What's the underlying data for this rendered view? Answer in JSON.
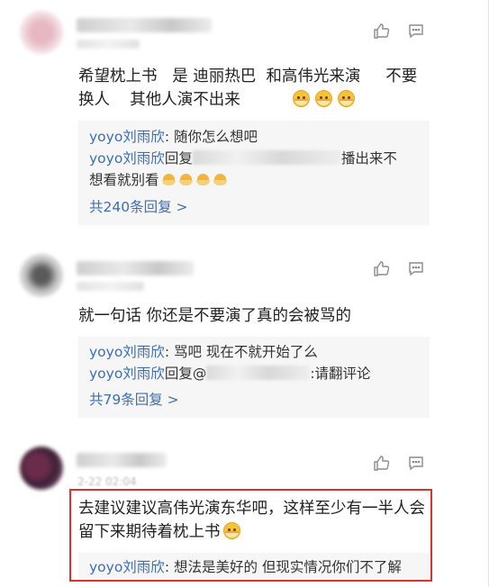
{
  "comments": [
    {
      "text_line1": "希望枕上书   是 迪丽热巴  和高伟光来演     不要",
      "text_line2": "换人    其他人演不出来",
      "emoji_count": 3,
      "replies": [
        {
          "name": "yoyo刘雨欣",
          "sep": ": ",
          "text": "随你怎么想吧"
        },
        {
          "name": "yoyo刘雨欣",
          "reply_word": "回复",
          "text_after": "播出来不",
          "cont": "想看就别看"
        }
      ],
      "more": "共240条回复 >"
    },
    {
      "text_line1": "就一句话 你还是不要演了真的会被骂的",
      "replies": [
        {
          "name": "yoyo刘雨欣",
          "sep": ": ",
          "text": "骂吧 现在不就开始了么"
        },
        {
          "name": "yoyo刘雨欣",
          "reply_word": "回复@",
          "text_after": ":请翻评论"
        }
      ],
      "more": "共79条回复 >"
    },
    {
      "date": "2-22 02:04",
      "text_line1": "去建议建议高伟光演东华吧，这样至少有一半人会",
      "text_line2": "留下来期待着枕上书",
      "replies": [
        {
          "name": "yoyo刘雨欣",
          "sep": ": ",
          "text": "想法是美好的 但现实情况你们不了解"
        }
      ]
    }
  ],
  "colors": {
    "link": "#3b6fb6",
    "highlight": "#e0302e",
    "reply_bg": "#f6f6f6"
  },
  "icons": [
    "thumbs-up-icon",
    "comment-icon"
  ]
}
